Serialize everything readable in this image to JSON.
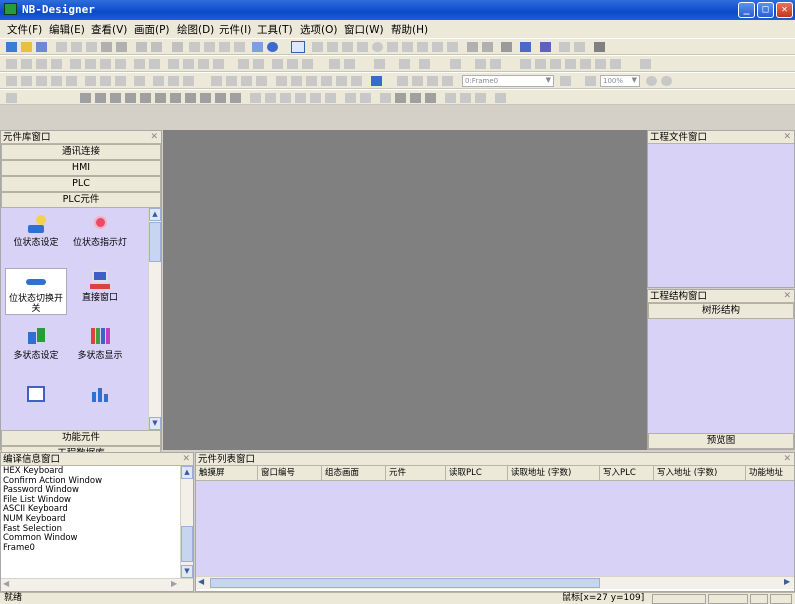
{
  "window": {
    "title": "NB-Designer",
    "min_label": "_",
    "max_label": "□",
    "close_label": "✕"
  },
  "menu": [
    "文件(F)",
    "编辑(E)",
    "查看(V)",
    "画面(P)",
    "绘图(D)",
    "元件(I)",
    "工具(T)",
    "选项(O)",
    "窗口(W)",
    "帮助(H)"
  ],
  "toolbar": {
    "frame_select": "0:Frame0",
    "zoom": "100%"
  },
  "component_library": {
    "title": "元件库窗口",
    "categories_top": [
      "通讯连接",
      "HMI",
      "PLC",
      "PLC元件"
    ],
    "components": [
      {
        "label": "位状态设定",
        "icon": "bit-state-set-icon"
      },
      {
        "label": "位状态指示灯",
        "icon": "bit-state-indicator-icon"
      },
      {
        "label": "位状态切换开关",
        "icon": "bit-state-switch-icon"
      },
      {
        "label": "直接窗口",
        "icon": "direct-window-icon"
      },
      {
        "label": "多状态设定",
        "icon": "multi-state-set-icon"
      },
      {
        "label": "多状态显示",
        "icon": "multi-state-display-icon"
      },
      {
        "label": "",
        "icon": "numeric-display-icon"
      },
      {
        "label": "",
        "icon": "chart-component-icon"
      }
    ],
    "categories_bottom": [
      "功能元件",
      "工程数据库"
    ]
  },
  "project_file": {
    "title": "工程文件窗口"
  },
  "project_structure": {
    "title": "工程结构窗口",
    "tab": "树形结构",
    "footer": "预览图"
  },
  "compile_info": {
    "title": "编译信息窗口",
    "items": [
      "HEX Keyboard",
      "Confirm Action Window",
      "Password Window",
      "File List Window",
      "ASCII Keyboard",
      "NUM Keyboard",
      "Fast Selection",
      "Common Window",
      "Frame0"
    ]
  },
  "element_list": {
    "title": "元件列表窗口",
    "columns": [
      "触摸屏",
      "窗口编号",
      "组态画面",
      "元件",
      "读取PLC",
      "读取地址 (字数)",
      "写入PLC",
      "写入地址 (字数)",
      "功能地址"
    ]
  },
  "status": {
    "text": "就绪",
    "coords": "鼠标[x=27 y=109]"
  },
  "colors": {
    "titlebar": "#0a4ac8",
    "canvas": "#808080",
    "panel_body": "#d8d2f6"
  }
}
